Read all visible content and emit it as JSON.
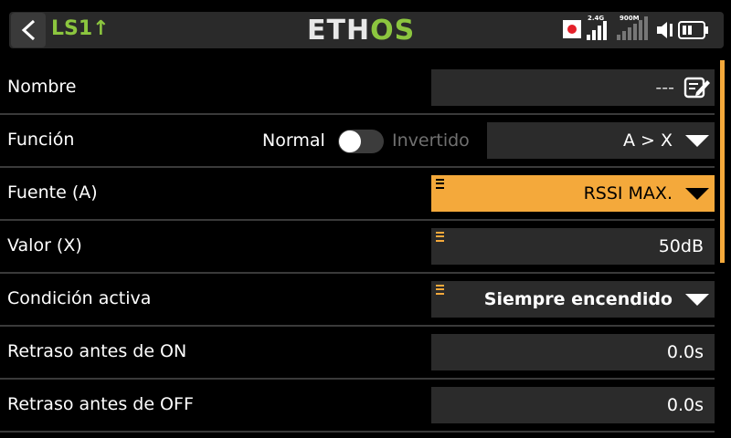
{
  "header": {
    "title": "LS1",
    "title_arrow": "↑",
    "logo_left": "ETH",
    "logo_right": "OS",
    "status": {
      "rf_24_label": "2.4G",
      "rf_900_label": "900M"
    }
  },
  "rows": {
    "nombre": {
      "label": "Nombre",
      "value": "---"
    },
    "funcion": {
      "label": "Función",
      "toggle_left": "Normal",
      "toggle_right": "Invertido",
      "value": "A > X",
      "toggle_on": false
    },
    "fuente": {
      "label": "Fuente (A)",
      "value": "RSSI MAX."
    },
    "valor": {
      "label": "Valor (X)",
      "value": "50dB"
    },
    "condicion": {
      "label": "Condición activa",
      "value": "Siempre encendido"
    },
    "retraso_on": {
      "label": "Retraso antes de ON",
      "value": "0.0s"
    },
    "retraso_off": {
      "label": "Retraso antes de OFF",
      "value": "0.0s"
    }
  },
  "colors": {
    "accent_orange": "#f4a93b",
    "brand_green": "#8cc63f",
    "field_bg": "#2b2b2b"
  }
}
